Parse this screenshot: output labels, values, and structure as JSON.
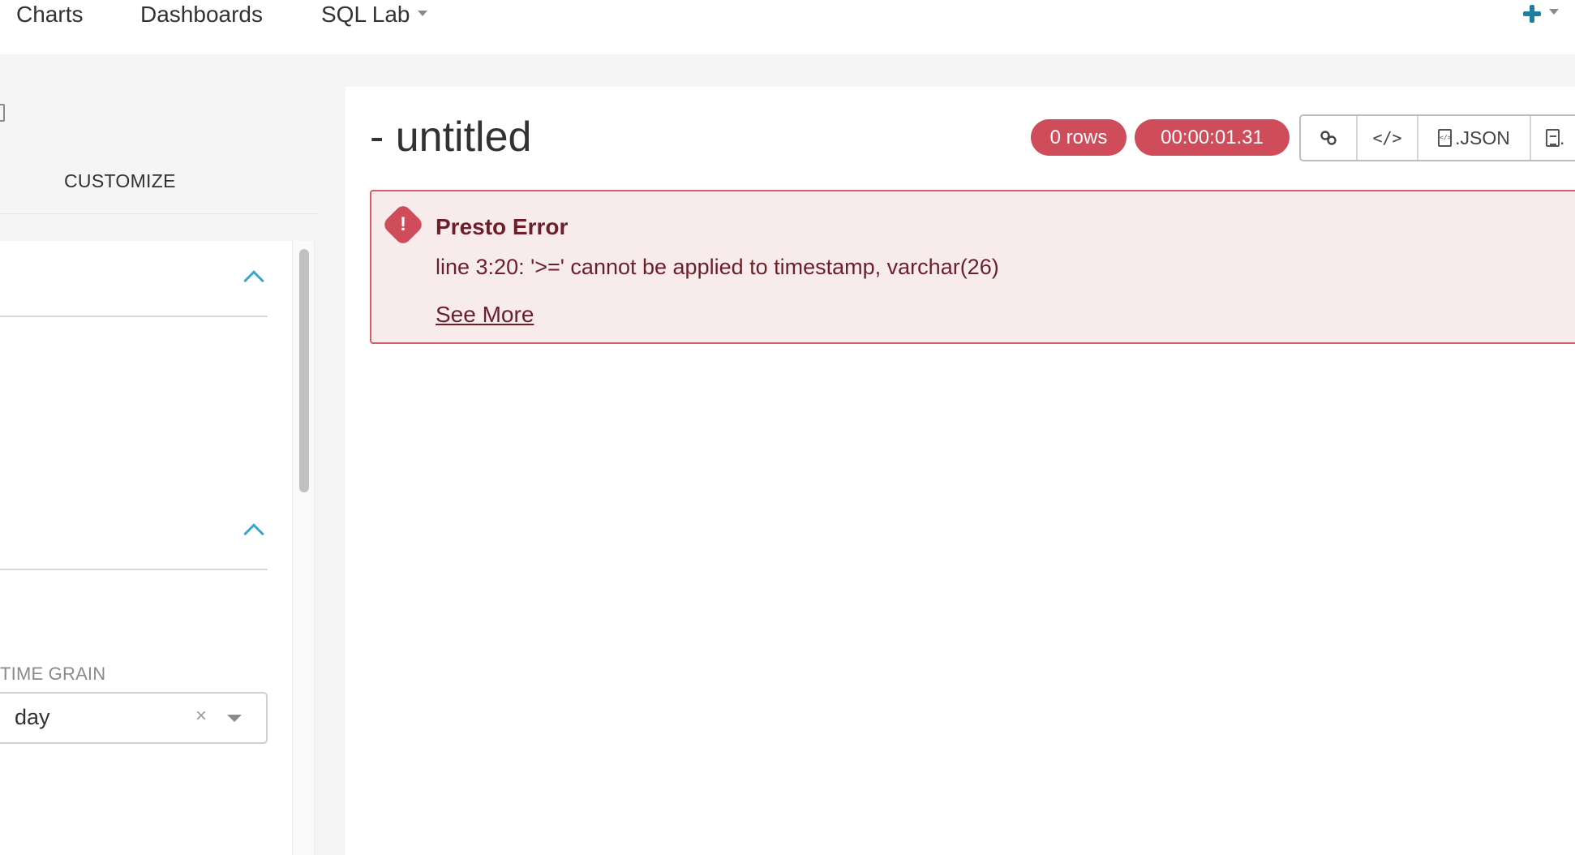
{
  "topnav": {
    "items": [
      {
        "label": "Charts"
      },
      {
        "label": "Dashboards"
      },
      {
        "label": "SQL Lab"
      }
    ],
    "accent_color": "#1f7fa3"
  },
  "left_panel": {
    "tab_label": "CUSTOMIZE",
    "time_grain": {
      "label": "TIME GRAIN",
      "value": "day",
      "clear_glyph": "×"
    }
  },
  "main": {
    "title": "- untitled",
    "rows_badge": "0 rows",
    "timer_badge": "00:00:01.31",
    "toolbar": {
      "json_label": ".JSON",
      "csv_label": "."
    },
    "error": {
      "title": "Presto Error",
      "message": "line 3:20: '>=' cannot be applied to timestamp, varchar(26)",
      "see_more": "See More",
      "icon_glyph": "!",
      "color": "#cf4c5a"
    }
  }
}
